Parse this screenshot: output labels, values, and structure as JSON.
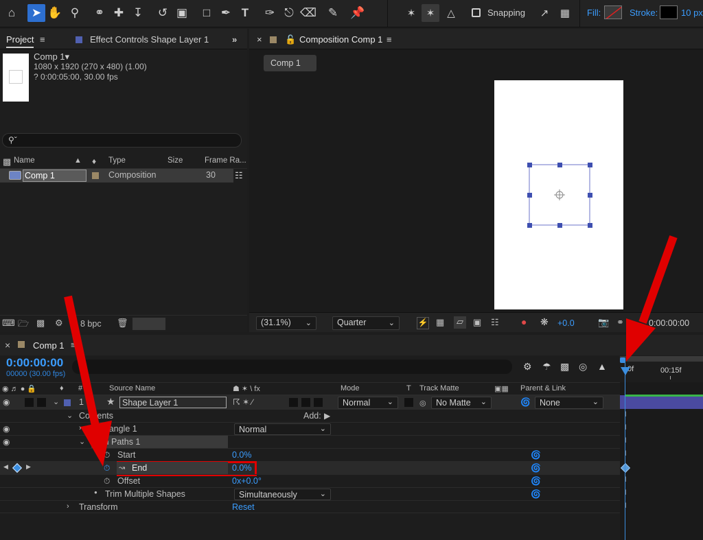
{
  "toolbar": {
    "snapping_label": "Snapping",
    "fill_label": "Fill:",
    "stroke_label": "Stroke:",
    "stroke_width": "10 px"
  },
  "project_panel": {
    "tab_project": "Project",
    "tab_effect_controls": "Effect Controls Shape Layer 1",
    "item_name": "Comp 1",
    "item_info_1": "1080 x 1920  (270 x 480) (1.00)",
    "item_info_2": "? 0:00:05:00, 30.00 fps",
    "search_placeholder": "",
    "columns": [
      "Name",
      "Type",
      "Size",
      "Frame Ra..."
    ],
    "items": [
      {
        "name": "Comp 1",
        "type": "Composition",
        "size": "",
        "frame_rate": "30"
      }
    ],
    "bpc_label": "8 bpc"
  },
  "composition_panel": {
    "tab_label": "Composition Comp 1",
    "comp_tab": "Comp 1",
    "zoom": "(31.1%)",
    "resolution": "Quarter",
    "exposure": "+0.0",
    "timecode": "0:00:00:00"
  },
  "timeline": {
    "tab_label": "Comp 1",
    "timecode": "0:00:00:00",
    "frame_info": "00000 (30.00 fps)",
    "ruler_labels": [
      "0f",
      "00:15f"
    ],
    "columns": {
      "source_name": "Source Name",
      "switches": "☗ ✶ \\ fx",
      "mode": "Mode",
      "t": "T",
      "track_matte": "Track Matte",
      "parent_link": "Parent & Link"
    },
    "layer": {
      "number": "1",
      "name": "Shape Layer 1",
      "mode": "Normal",
      "track_matte": "No Matte",
      "parent": "None"
    },
    "contents_label": "Contents",
    "add_label": "Add:",
    "rectangle_label": "Rectangle 1",
    "rectangle_mode": "Normal",
    "trim_label": "Trim Paths 1",
    "start_label": "Start",
    "start_value": "0.0%",
    "end_label": "End",
    "end_value": "0.0%",
    "offset_label": "Offset",
    "offset_value": "0x+0.0°",
    "trim_multiple_label": "Trim Multiple Shapes",
    "trim_multiple_value": "Simultaneously",
    "transform_label": "Transform",
    "reset_label": "Reset"
  },
  "colors": {
    "accent_blue": "#2d6fd0",
    "highlight_red": "#e00000",
    "layer_bar": "#4a4aa0"
  }
}
